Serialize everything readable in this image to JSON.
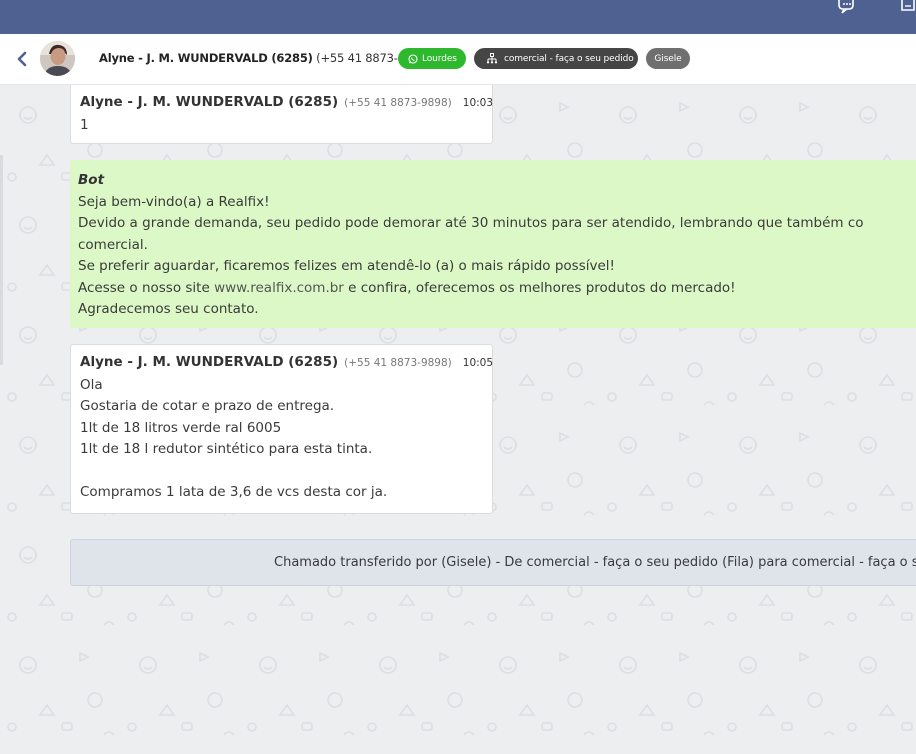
{
  "header": {
    "contact_name": "Alyne - J. M. WUNDERVALD (6285)",
    "contact_phone": "(+55 41 8873-9898)",
    "tags": {
      "agent_tag": "Lourdes",
      "queue_tag": "comercial - faça o seu pedido",
      "user_tag": "Gisele"
    },
    "colors": {
      "topbar": "#4f6190",
      "agent_tag": "#2eb82e",
      "queue_tag": "#454545",
      "user_tag": "#6f6f6f"
    }
  },
  "messages": {
    "m1": {
      "sender": "Alyne - J. M. WUNDERVALD (6285)",
      "phone": "(+55 41 8873-9898)",
      "time": "10:03",
      "lines": [
        "1"
      ]
    },
    "m2": {
      "sender": "Bot",
      "lines": [
        "Seja bem-vindo(a) a Realfix!",
        "Devido a grande demanda, seu pedido pode demorar até 30 minutos para ser atendido, lembrando que também co",
        "comercial.",
        "Se preferir aguardar, ficaremos felizes em atendê-lo (a) o mais rápido possível!"
      ],
      "line5_pre": "Acesse o nosso site ",
      "line5_link": "www.realfix.com.br",
      "line5_post": " e confira, oferecemos os melhores produtos do mercado!",
      "line6": "Agradecemos seu contato.",
      "color": "#dcf8c6"
    },
    "m3": {
      "sender": "Alyne - J. M. WUNDERVALD (6285)",
      "phone": "(+55 41 8873-9898)",
      "time": "10:05",
      "lines": [
        "Ola",
        "Gostaria de cotar e prazo de entrega.",
        "1lt de 18 litros verde ral 6005",
        "1lt de 18 l redutor sintético para esta tinta.",
        "",
        "Compramos 1 lata de 3,6 de vcs desta cor ja."
      ]
    }
  },
  "system_message": "Chamado transferido por (Gisele) - De comercial - faça o seu pedido (Fila) para comercial - faça o seu pedido",
  "icons": [
    "chat-bubbles-icon",
    "document-icon",
    "chevron-left-icon",
    "whatsapp-icon",
    "sitemap-icon"
  ]
}
